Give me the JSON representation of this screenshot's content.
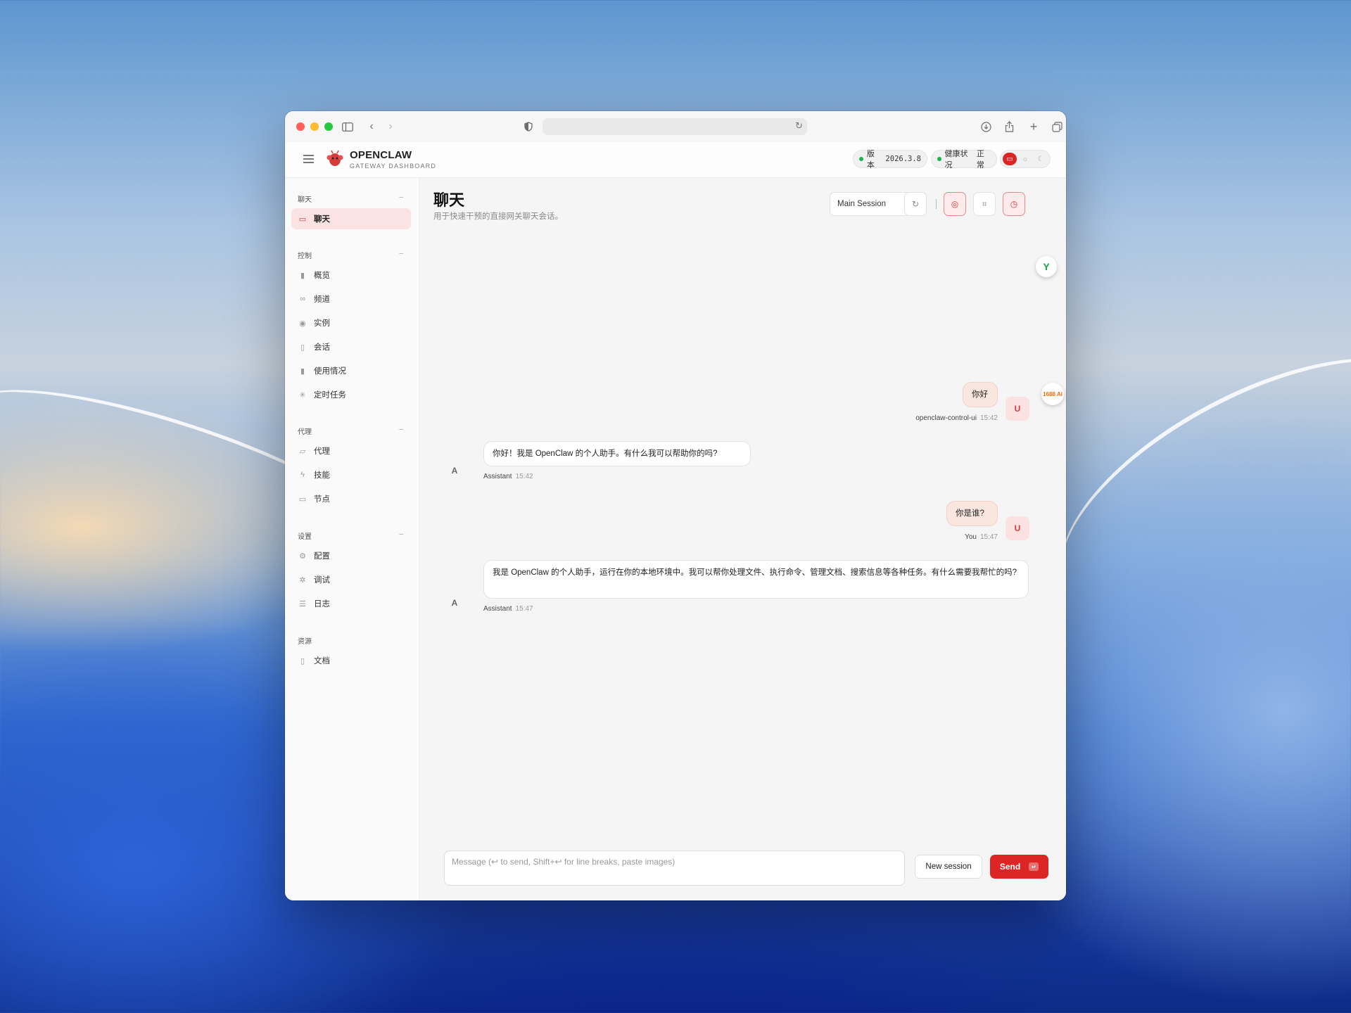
{
  "browser": {
    "url": "",
    "icons": [
      "sidebar-toggle-icon",
      "back-icon",
      "forward-icon",
      "privacy-shield-icon",
      "reload-icon",
      "download-icon",
      "share-icon",
      "new-tab-icon",
      "tabs-overview-icon"
    ]
  },
  "header": {
    "brand": "OPENCLAW",
    "brand_sub": "GATEWAY DASHBOARD",
    "version_label": "版本",
    "version_value": "2026.3.8",
    "health_label": "健康状况",
    "health_value": "正常"
  },
  "sidebar": {
    "sections": [
      {
        "title": "聊天",
        "items": [
          {
            "label": "聊天",
            "icon": "message-icon",
            "active": true
          }
        ]
      },
      {
        "title": "控制",
        "items": [
          {
            "label": "概览",
            "icon": "bar-chart-icon"
          },
          {
            "label": "频道",
            "icon": "link-icon"
          },
          {
            "label": "实例",
            "icon": "radio-icon"
          },
          {
            "label": "会话",
            "icon": "document-icon"
          },
          {
            "label": "使用情况",
            "icon": "bar-chart-icon"
          },
          {
            "label": "定时任务",
            "icon": "loader-icon"
          }
        ]
      },
      {
        "title": "代理",
        "items": [
          {
            "label": "代理",
            "icon": "folder-icon"
          },
          {
            "label": "技能",
            "icon": "lightning-icon"
          },
          {
            "label": "节点",
            "icon": "monitor-icon"
          }
        ]
      },
      {
        "title": "设置",
        "items": [
          {
            "label": "配置",
            "icon": "gear-icon"
          },
          {
            "label": "调试",
            "icon": "bug-icon"
          },
          {
            "label": "日志",
            "icon": "scroll-icon"
          }
        ]
      },
      {
        "title": "资源",
        "items": [
          {
            "label": "文档",
            "icon": "book-icon"
          }
        ]
      }
    ]
  },
  "main": {
    "title": "聊天",
    "subtitle": "用于快速干预的直接网关聊天会话。",
    "session_select": "Main Session",
    "messages": [
      {
        "role": "user",
        "text": "你好",
        "sender": "openclaw-control-ui",
        "time": "15:42",
        "avatar": "U"
      },
      {
        "role": "assistant",
        "text": "你好！我是 OpenClaw 的个人助手。有什么我可以帮助你的吗?",
        "sender": "Assistant",
        "time": "15:42",
        "avatar": "A"
      },
      {
        "role": "user",
        "text": "你是谁?",
        "sender": "You",
        "time": "15:47",
        "avatar": "U"
      },
      {
        "role": "assistant",
        "text": "我是 OpenClaw 的个人助手，运行在你的本地环境中。我可以帮你处理文件、执行命令、管理文档、搜索信息等各种任务。有什么需要我帮忙的吗?",
        "sender": "Assistant",
        "time": "15:47",
        "avatar": "A"
      }
    ],
    "composer_placeholder": "Message (↩ to send, Shift+↩ for line breaks, paste images)",
    "new_session_label": "New session",
    "send_label": "Send",
    "send_kbd": "↵"
  },
  "floating": {
    "ext1": "Y",
    "ext2": "1688 AI"
  },
  "colors": {
    "accent": "#dc2626",
    "active_bg": "#fbe3e3",
    "user_bubble": "#f9e6df",
    "health_dot": "#22b14c"
  }
}
